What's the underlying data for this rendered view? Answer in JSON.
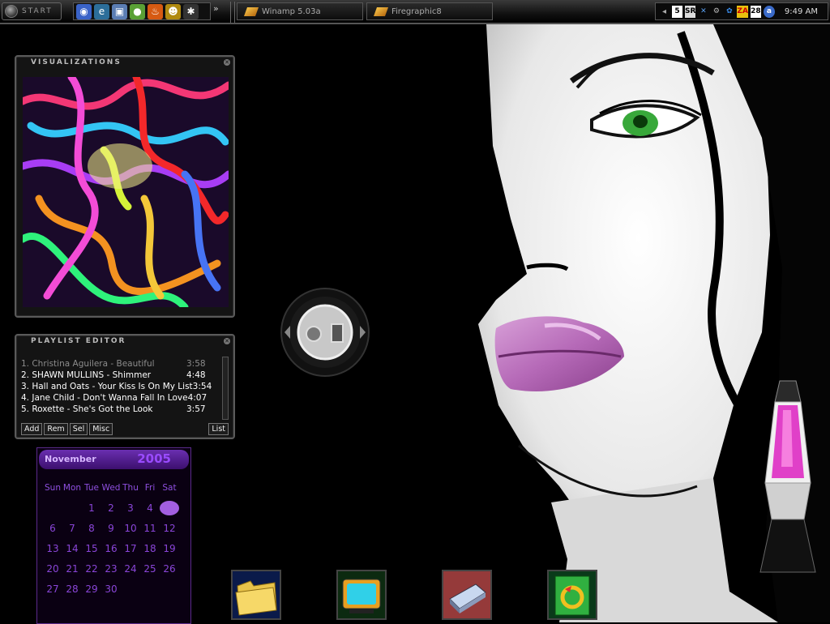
{
  "taskbar": {
    "start_label": "START",
    "chevron": "»",
    "tasks": [
      {
        "label": "Winamp 5.03a"
      },
      {
        "label": "Firegraphic8"
      }
    ],
    "tray": {
      "calendar_badge": "5",
      "sr_badge": "SR",
      "za_badge": "ZA",
      "date_badge": "28",
      "clock": "9:49 AM"
    }
  },
  "visualizations": {
    "title": "VISUALIZATIONS"
  },
  "playlist": {
    "title": "PLAYLIST EDITOR",
    "items": [
      {
        "title": "1. Christina Aguilera - Beautiful",
        "duration": "3:58"
      },
      {
        "title": "2. SHAWN MULLINS - Shimmer",
        "duration": "4:48"
      },
      {
        "title": "3. Hall and Oats - Your Kiss Is On My List",
        "duration": "3:54"
      },
      {
        "title": "4. Jane Child - Don't Wanna Fall In Love",
        "duration": "4:07"
      },
      {
        "title": "5. Roxette - She's Got the Look",
        "duration": "3:57"
      }
    ],
    "buttons": {
      "add": "Add",
      "rem": "Rem",
      "sel": "Sel",
      "misc": "Misc",
      "list": "List"
    }
  },
  "calendar": {
    "month": "November",
    "year": "2005",
    "days": [
      "Sun",
      "Mon",
      "Tue",
      "Wed",
      "Thu",
      "Fri",
      "Sat"
    ],
    "dates": [
      "",
      "",
      "1",
      "2",
      "3",
      "4",
      "5",
      "6",
      "7",
      "8",
      "9",
      "10",
      "11",
      "12",
      "13",
      "14",
      "15",
      "16",
      "17",
      "18",
      "19",
      "20",
      "21",
      "22",
      "23",
      "24",
      "25",
      "26",
      "27",
      "28",
      "29",
      "30"
    ],
    "today": "5"
  },
  "colors": {
    "calendar_accent": "#8a45d8",
    "lava_pink": "#e040c8"
  },
  "dock_icons": [
    "folder-icon",
    "tv-icon",
    "drive-icon",
    "recycle-icon"
  ]
}
